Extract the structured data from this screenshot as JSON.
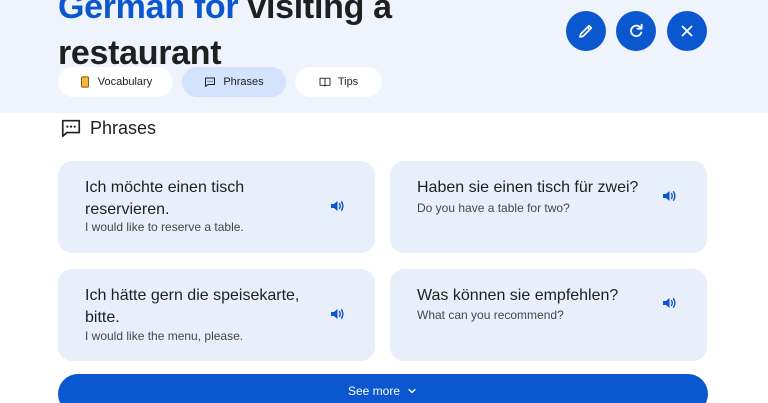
{
  "header": {
    "title_accent": "German for",
    "title_rest": "visiting a restaurant",
    "actions": [
      {
        "icon": "pencil-icon"
      },
      {
        "icon": "refresh-icon"
      },
      {
        "icon": "close-icon"
      }
    ]
  },
  "tabs": [
    {
      "label": "Vocabulary",
      "icon": "flashcard-icon",
      "active": false
    },
    {
      "label": "Phrases",
      "icon": "chat-bubble-icon",
      "active": true
    },
    {
      "label": "Tips",
      "icon": "book-icon",
      "active": false
    }
  ],
  "section": {
    "title": "Phrases",
    "icon": "chat-bubble-icon"
  },
  "phrases": [
    {
      "german": "Ich möchte einen tisch reservieren.",
      "english": "I would like to reserve a table."
    },
    {
      "german": "Haben sie einen tisch für zwei?",
      "english": "Do you have a table for two?"
    },
    {
      "german": "Ich hätte gern die speisekarte, bitte.",
      "english": "I would like the menu, please."
    },
    {
      "german": "Was können sie empfehlen?",
      "english": "What can you recommend?"
    }
  ],
  "see_more": {
    "label": "See more",
    "icon": "chevron-down-icon"
  },
  "colors": {
    "accent": "#0b57d0",
    "header_bg": "#eef3fc",
    "card_bg": "#e8effb",
    "active_tab": "#d3e3fd"
  }
}
